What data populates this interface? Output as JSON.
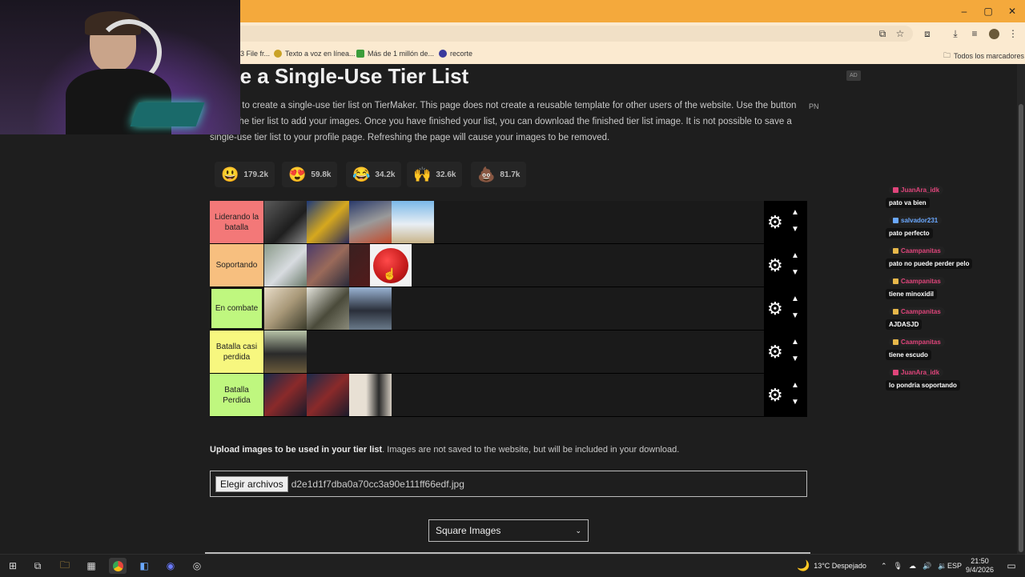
{
  "window": {
    "controls": [
      "–",
      "▢",
      "✕"
    ]
  },
  "bookmarks": [
    {
      "label": "3 File fr...",
      "color": "#555555"
    },
    {
      "label": "Texto a voz en línea...",
      "color": "#c9a227"
    },
    {
      "label": "Más de 1 millón de...",
      "color": "#3a9d3a"
    },
    {
      "label": "recorte",
      "color": "#3a3a9d"
    }
  ],
  "bookmarks_folder": "Todos los marcadores",
  "page": {
    "title": "eate a Single-Use Tier List",
    "intro": "is page to create a single-use tier list on TierMaker. This page does not create a reusable template for other users of the website. Use the button below the tier list to add your images. Once you have finished your list, you can download the finished tier list image. It is not possible to save a single-use tier list to your profile page. Refreshing the page will cause your images to be removed.",
    "ad_label": "AD",
    "pn_label": "PN"
  },
  "reactions": [
    {
      "emoji": "😃",
      "count": "179.2k"
    },
    {
      "emoji": "😍",
      "count": "59.8k"
    },
    {
      "emoji": "😂",
      "count": "34.2k"
    },
    {
      "emoji": "🙌",
      "count": "32.6k"
    },
    {
      "emoji": "💩",
      "count": "81.7k"
    }
  ],
  "tiers": [
    {
      "label": "Liderando la batalla",
      "color": "#f37878",
      "image_count": 4
    },
    {
      "label": "Soportando",
      "color": "#f7bf7f",
      "image_count": 4
    },
    {
      "label": "En combate",
      "color": "#bff77f",
      "image_count": 3
    },
    {
      "label": "Batalla casi perdida",
      "color": "#f7f77f",
      "image_count": 1
    },
    {
      "label": "Batalla Perdida",
      "color": "#bff77f",
      "image_count": 3
    }
  ],
  "upload": {
    "bold": "Upload images to be used in your tier list",
    "rest": ". Images are not saved to the website, but will be included in your download.",
    "button": "Elegir archivos",
    "filename": "d2e1d1f7dba0a70cc3a90e111ff66edf.jpg"
  },
  "image_shape_select": "Square Images",
  "chat": [
    {
      "user": "JuanAra_idk",
      "color": "#e0457b",
      "text": "pato va bien"
    },
    {
      "user": "salvador231",
      "color": "#6aa8ff",
      "text": "pato perfecto"
    },
    {
      "user": "Caampanitas",
      "color": "#e0457b",
      "text": "pato no puede perder pelo"
    },
    {
      "user": "Caampanitas",
      "color": "#e0457b",
      "text": "tiene minoxidil"
    },
    {
      "user": "Caampanitas",
      "color": "#e0457b",
      "text": "AJDASJD"
    },
    {
      "user": "Caampanitas",
      "color": "#e0457b",
      "text": "tiene escudo"
    },
    {
      "user": "JuanAra_idk",
      "color": "#e0457b",
      "text": "lo pondria soportando"
    }
  ],
  "taskbar": {
    "weather": "13°C  Despejado",
    "lang": "ESP",
    "time": "21:50",
    "date": "9/4/2026"
  }
}
